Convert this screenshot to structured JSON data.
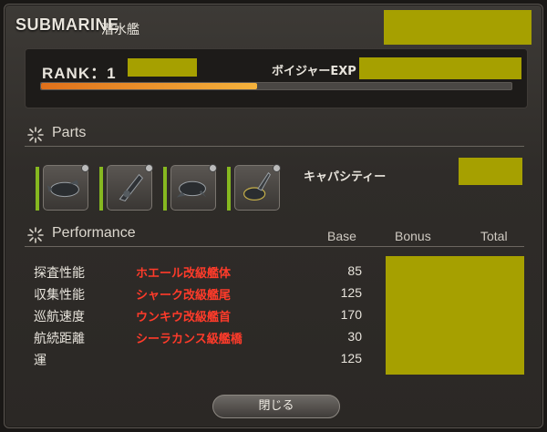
{
  "header": {
    "title": "SUBMARINE",
    "subtitle": "潜水艦"
  },
  "rank": {
    "label": "RANK：1",
    "voyage_label": "ボイジャーEXP",
    "exp_progress_fraction": 0.46
  },
  "parts": {
    "heading": "Parts",
    "capacity_label": "キャパシティー",
    "slots": [
      {
        "icon": "submarine-hull-icon"
      },
      {
        "icon": "submarine-stern-icon"
      },
      {
        "icon": "submarine-bow-icon"
      },
      {
        "icon": "submarine-bridge-icon"
      }
    ]
  },
  "performance": {
    "heading": "Performance",
    "columns": {
      "base": "Base",
      "bonus": "Bonus",
      "total": "Total"
    },
    "rows": [
      {
        "name": "探査性能",
        "part": "ホエール改級艦体",
        "base": "85"
      },
      {
        "name": "収集性能",
        "part": "シャーク改級艦尾",
        "base": "125"
      },
      {
        "name": "巡航速度",
        "part": "ウンキウ改級艦首",
        "base": "170"
      },
      {
        "name": "航続距離",
        "part": "シーラカンス級艦橋",
        "base": "30"
      },
      {
        "name": "運",
        "part": "",
        "base": "125"
      }
    ]
  },
  "footer": {
    "close_label": "閉じる"
  },
  "colors": {
    "accent_orange": "#e0701a",
    "part_red": "#ff3b2a",
    "slot_green": "#86b820",
    "redaction": "#a6a000"
  }
}
